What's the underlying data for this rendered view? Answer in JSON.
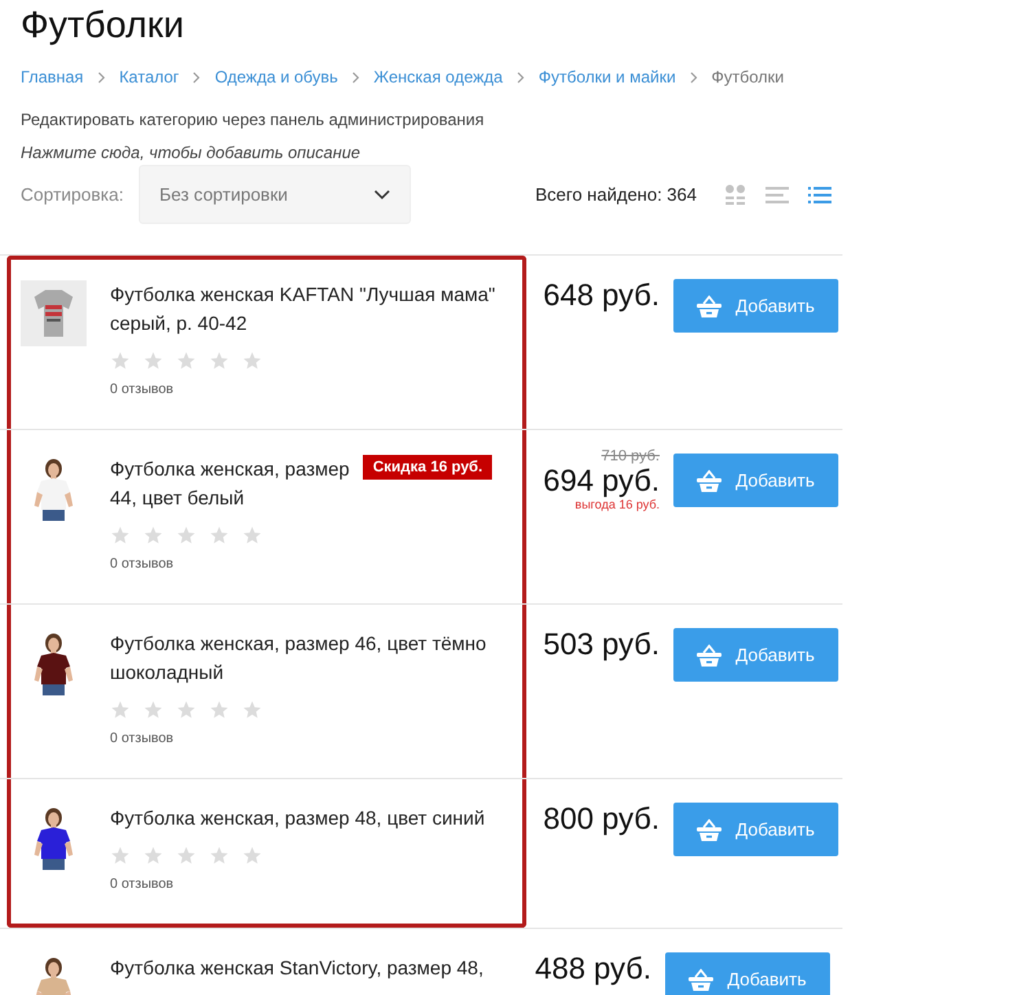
{
  "page_title": "Футболки",
  "breadcrumbs": [
    {
      "label": "Главная",
      "link": true
    },
    {
      "label": "Каталог",
      "link": true
    },
    {
      "label": "Одежда и обувь",
      "link": true
    },
    {
      "label": "Женская одежда",
      "link": true
    },
    {
      "label": "Футболки и майки",
      "link": true
    },
    {
      "label": "Футболки",
      "link": false
    }
  ],
  "admin_link": "Редактировать категорию через панель администрирования",
  "description_hint": "Нажмите сюда, чтобы добавить описание",
  "sort": {
    "label": "Сортировка:",
    "value": "Без сортировки"
  },
  "total_found": "Всего найдено: 364",
  "view_modes": [
    {
      "kind": "tiles",
      "selected": false
    },
    {
      "kind": "list",
      "selected": false
    },
    {
      "kind": "detailed",
      "selected": true
    }
  ],
  "products": [
    {
      "kind": "picture",
      "title_lines": [
        "Футболка женская KAFTAN \"Лучшая мама\"",
        "серый, р. 40-42"
      ],
      "stars": 0,
      "reviews": "0 отзывов",
      "price": "648 руб.",
      "button": "Добавить",
      "highlighted": true
    },
    {
      "kind": "picture",
      "title_lines": [
        "Футболка женская, размер",
        "44, цвет белый"
      ],
      "badge": "Скидка 16 руб.",
      "old_price": "710 руб.",
      "stars": 0,
      "reviews": "0 отзывов",
      "price": "694 руб.",
      "saving": "выгода 16 руб.",
      "button": "Добавить",
      "highlighted": true
    },
    {
      "kind": "picture",
      "title_lines": [
        "Футболка женская, размер 46, цвет тёмно",
        "шоколадный"
      ],
      "stars": 0,
      "reviews": "0 отзывов",
      "price": "503 руб.",
      "button": "Добавить",
      "highlighted": true
    },
    {
      "kind": "picture",
      "title_lines": [
        "Футболка женская, размер 48, цвет синий"
      ],
      "stars": 0,
      "reviews": "0 отзывов",
      "price": "800 руб.",
      "button": "Добавить",
      "highlighted": true
    },
    {
      "kind": "picture",
      "title_lines": [
        "Футболка женская StanVictory, размер 48,"
      ],
      "price": "488 руб.",
      "button": "Добавить",
      "highlighted": false
    }
  ]
}
